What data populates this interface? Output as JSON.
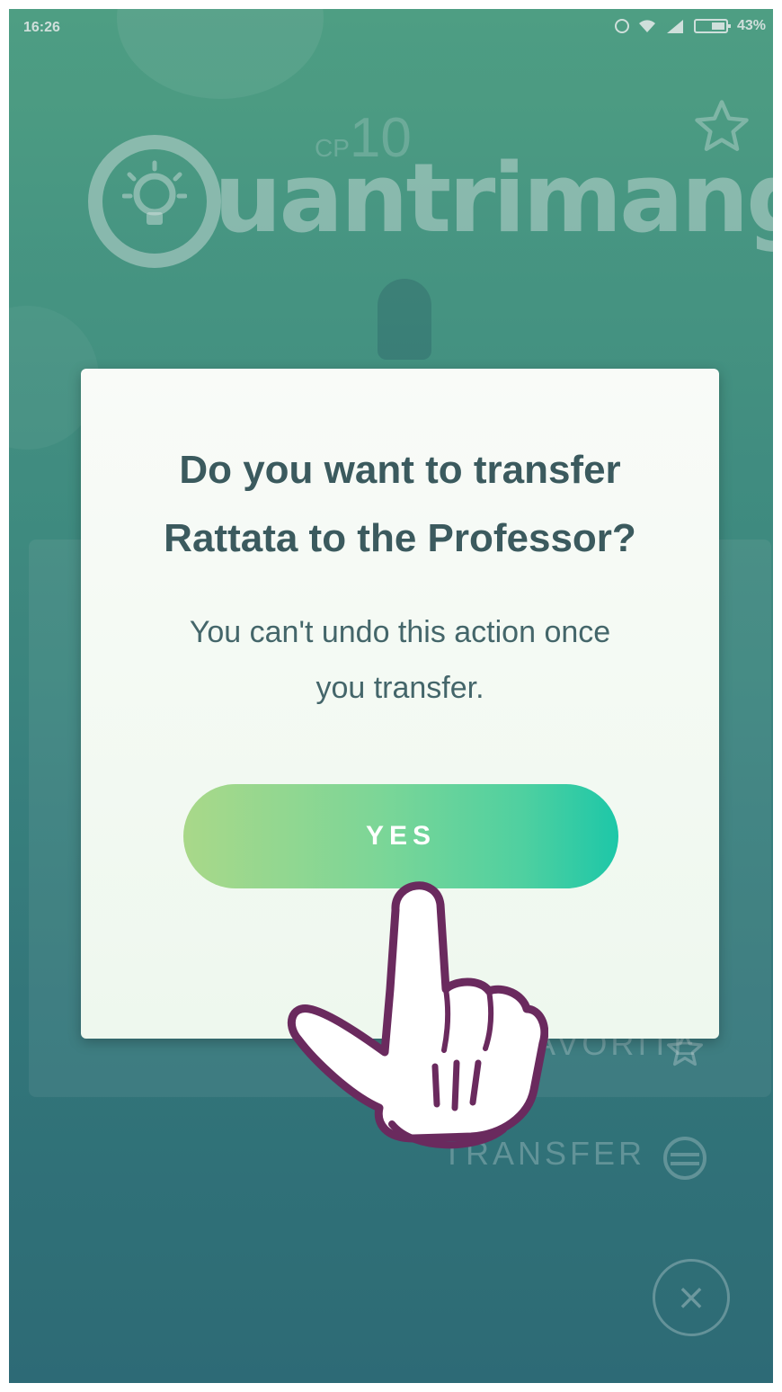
{
  "status_bar": {
    "time": "16:26",
    "battery_percent": "43%",
    "icons": [
      "alarm-icon",
      "wifi-icon",
      "signal-icon",
      "battery-icon"
    ]
  },
  "background": {
    "cp_label": "CP",
    "cp_value": "10",
    "watermark_text": "uantrimang",
    "menu": {
      "favorite_label": "FAVORITE",
      "transfer_label": "TRANSFER"
    },
    "close_symbol": "×"
  },
  "dialog": {
    "title_line1": "Do you want to transfer",
    "title_line2": "Rattata to the Professor?",
    "message_line1": "You can't undo this action once",
    "message_line2": "you transfer.",
    "yes_label": "YES"
  },
  "colors": {
    "background_top": "#55a98a",
    "background_bottom": "#2f6e7b",
    "dialog_text": "#3b5a5e",
    "button_gradient_start": "#a9d889",
    "button_gradient_end": "#1dc7a8"
  }
}
